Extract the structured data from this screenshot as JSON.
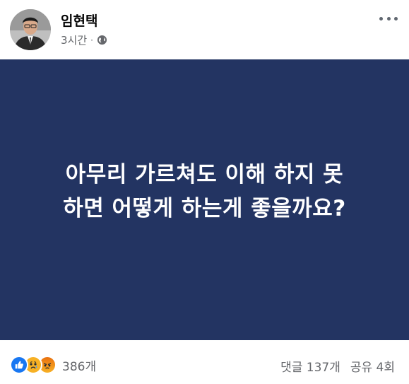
{
  "post": {
    "author": "임현택",
    "time": "3시간",
    "separator": "·",
    "privacy_icon": "globe-icon",
    "more_icon": "more-options-icon"
  },
  "card": {
    "background_color": "#233462",
    "text_color": "#ffffff",
    "line1": "아무리 가르쳐도 이해 하지 못",
    "line2": "하면 어떻게 하는게 좋을까요?"
  },
  "footer": {
    "reaction_icons": [
      "like-icon",
      "sad-icon",
      "angry-icon"
    ],
    "reaction_count": "386개",
    "comments": "댓글 137개",
    "shares": "공유 4회"
  }
}
